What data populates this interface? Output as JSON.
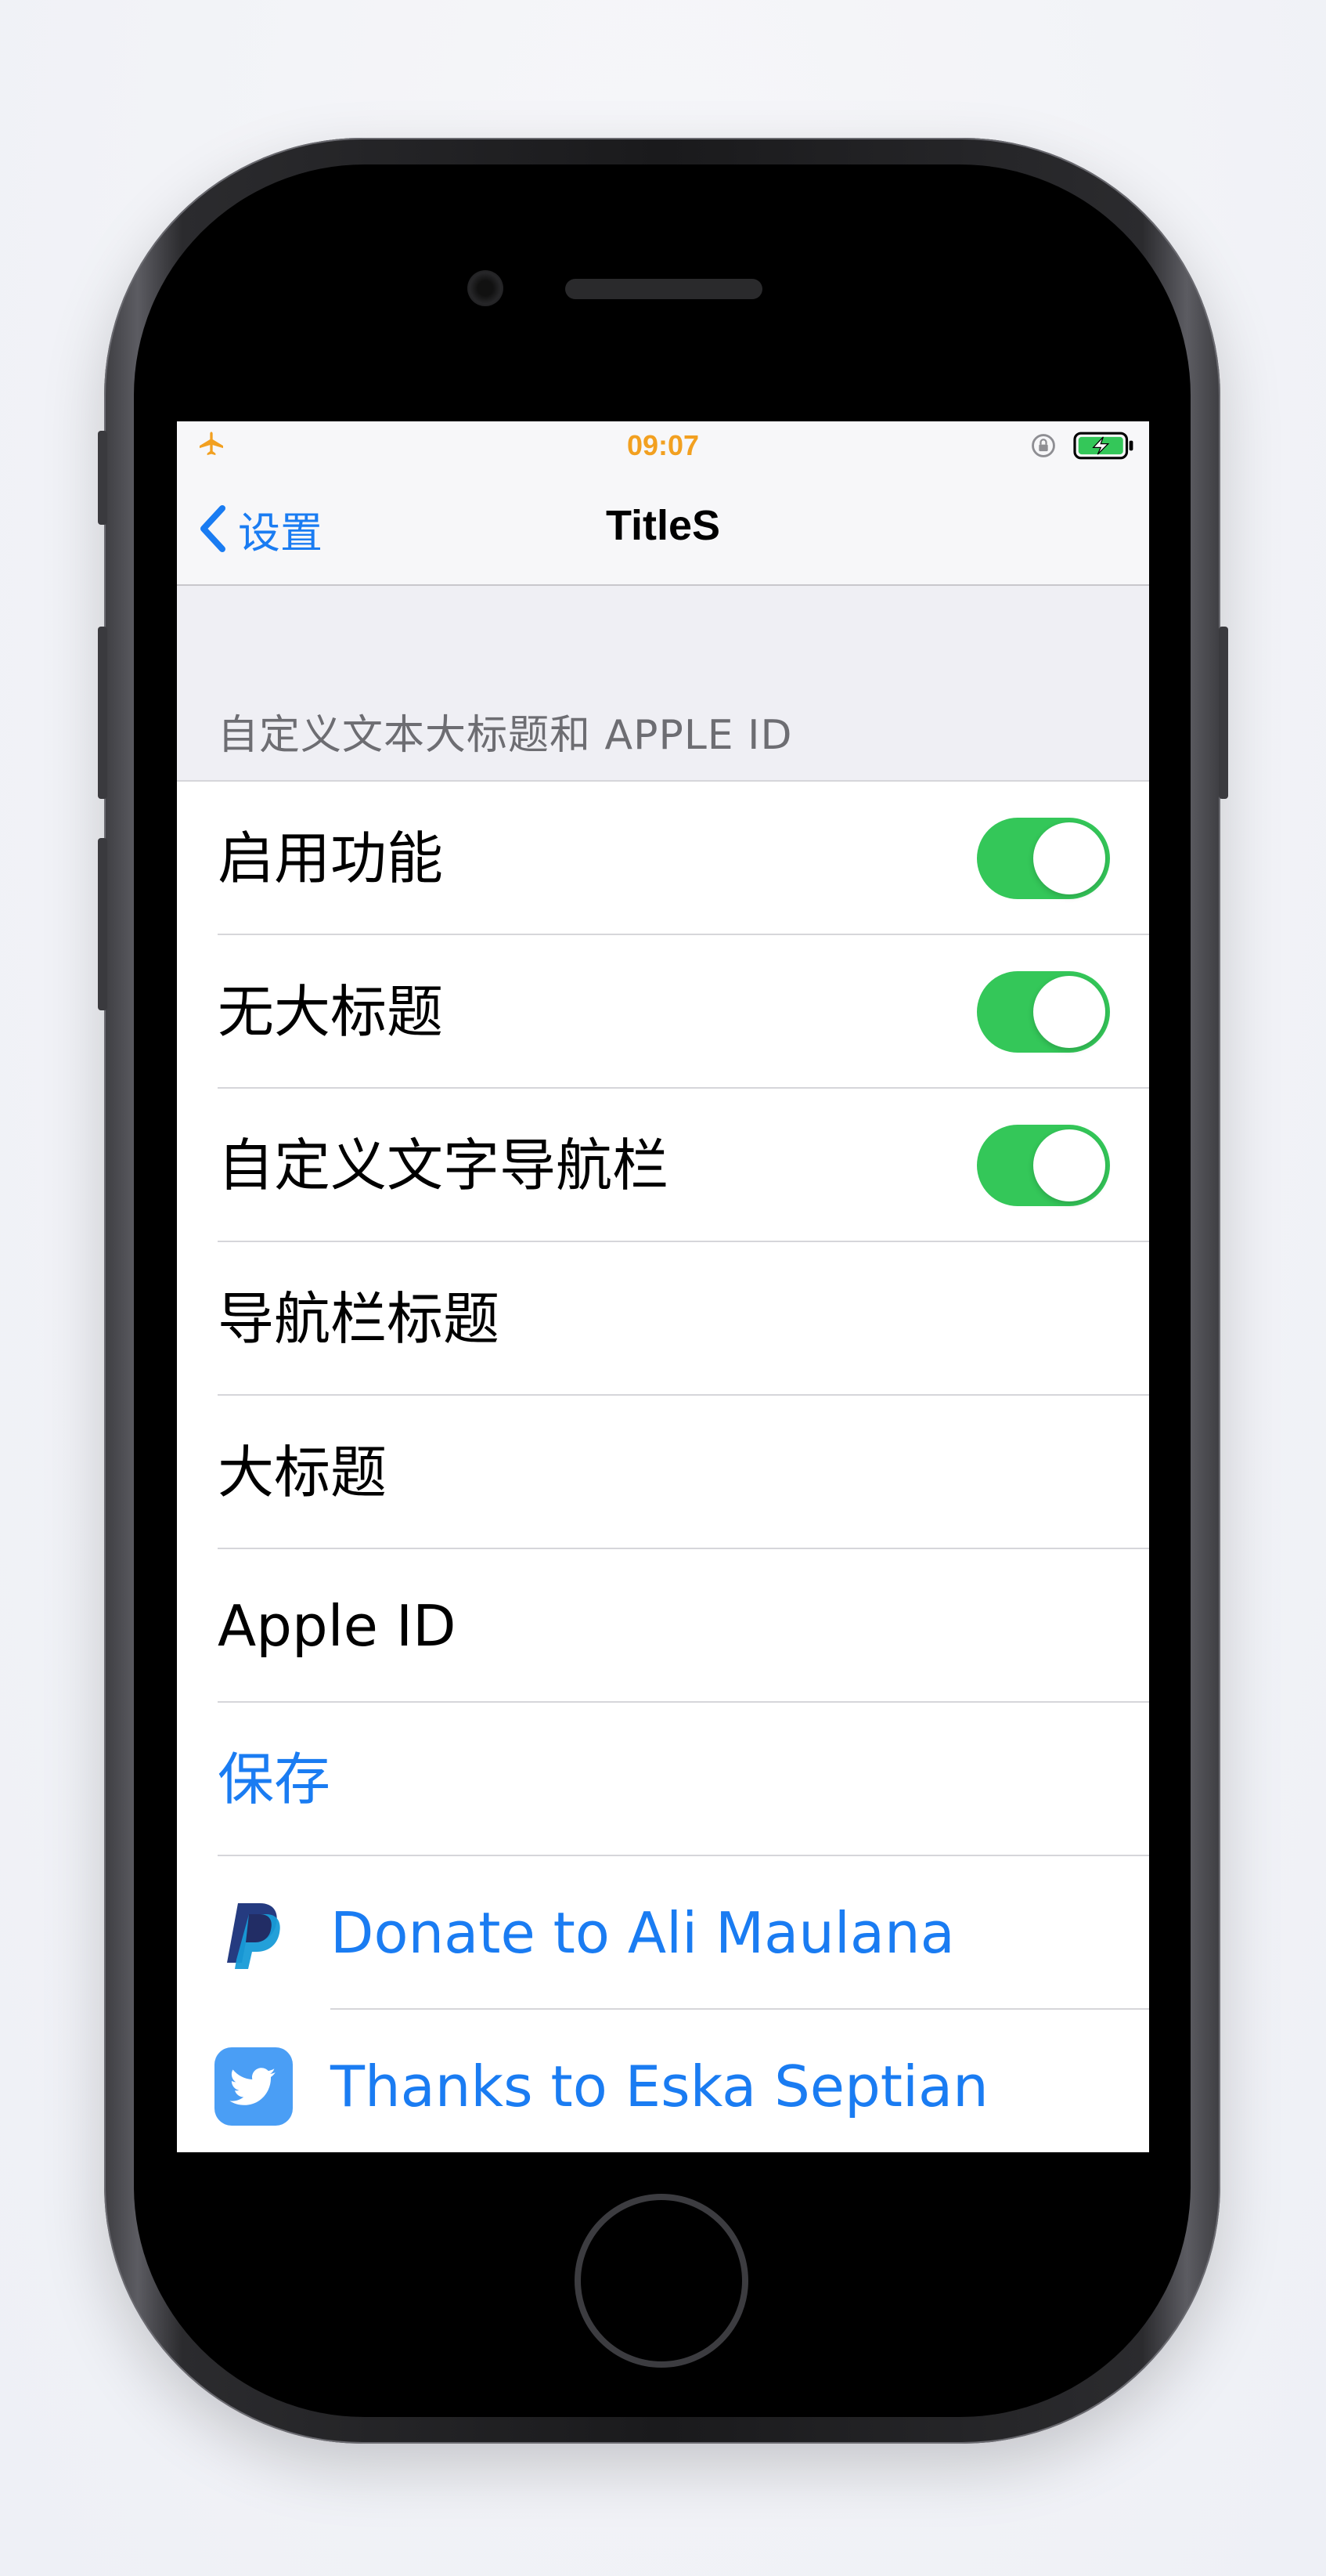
{
  "status_bar": {
    "time": "09:07",
    "airplane_icon": "airplane-icon",
    "lock_icon": "orientation-lock-icon",
    "battery_icon": "battery-charging-icon"
  },
  "nav": {
    "back_label": "设置",
    "title": "TitleS"
  },
  "section": {
    "header": "自定义文本大标题和 APPLE ID"
  },
  "rows": [
    {
      "label": "启用功能",
      "toggle_on": true
    },
    {
      "label": "无大标题",
      "toggle_on": true
    },
    {
      "label": "自定义文字导航栏",
      "toggle_on": true
    },
    {
      "label": "导航栏标题"
    },
    {
      "label": "大标题"
    },
    {
      "label": "Apple ID"
    },
    {
      "label": "保存"
    },
    {
      "label": "Donate to Ali Maulana",
      "icon": "paypal-icon"
    },
    {
      "label": "Thanks to Eska Septian",
      "icon": "twitter-icon"
    }
  ],
  "colors": {
    "accent_blue": "#1a7cf2",
    "toggle_green": "#34c759",
    "time_orange": "#f2a020",
    "grouped_background": "#efeff4",
    "separator": "#d6d6da"
  }
}
